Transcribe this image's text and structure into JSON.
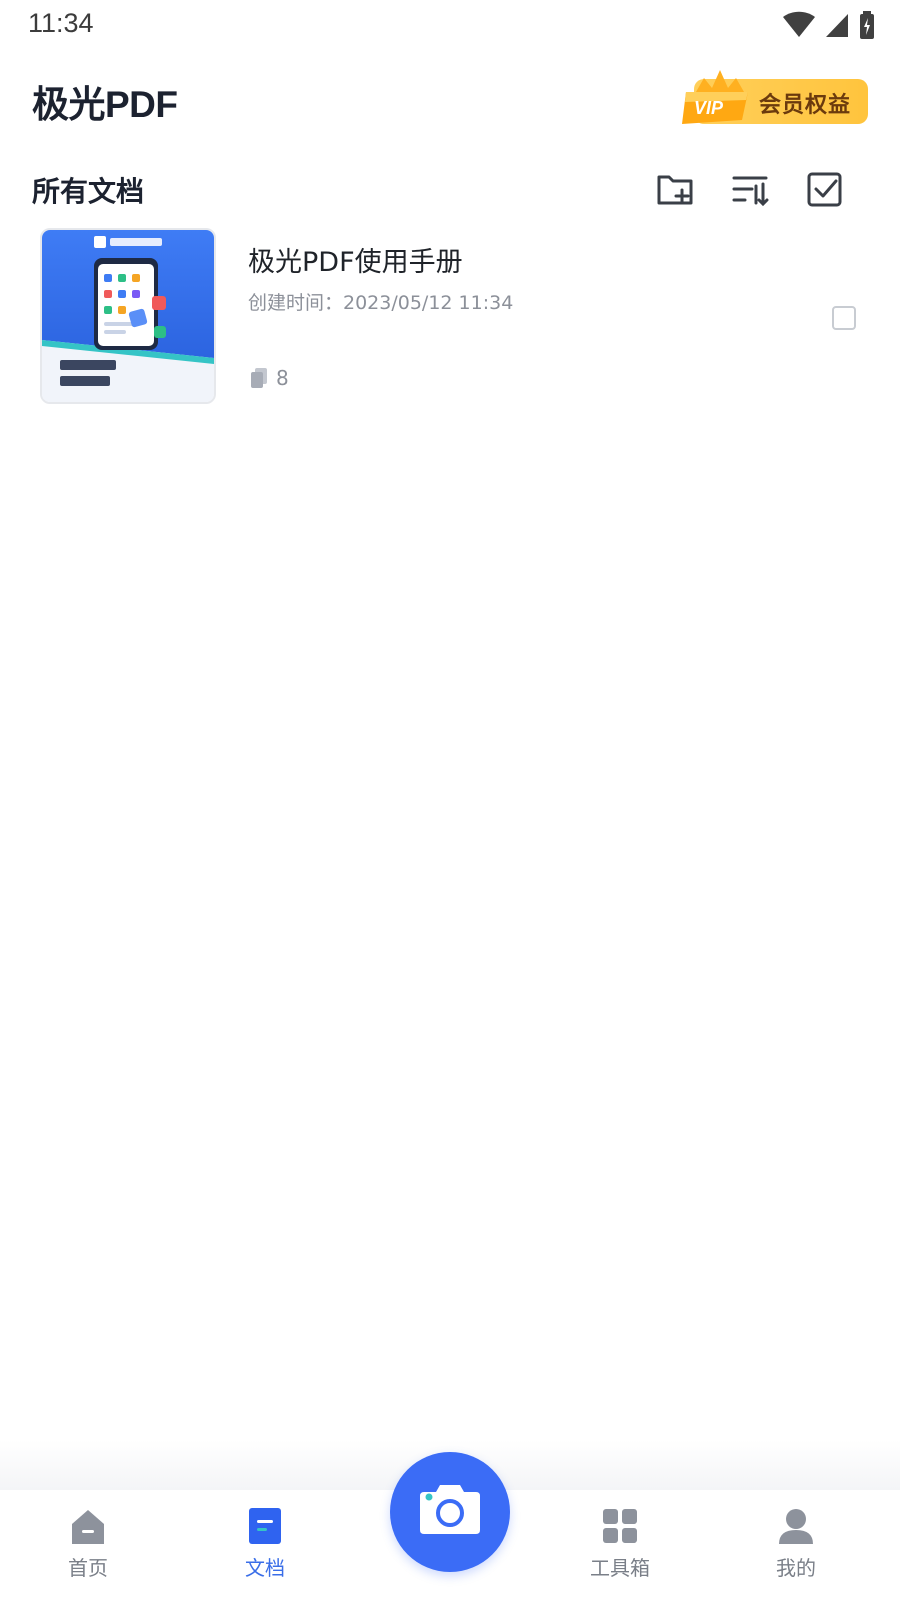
{
  "status_bar": {
    "time": "11:34"
  },
  "header": {
    "app_title": "极光PDF",
    "vip_label": "会员权益",
    "vip_badge_text": "VIP"
  },
  "section": {
    "title": "所有文档",
    "icons": [
      "new-folder-icon",
      "sort-icon",
      "multi-select-icon"
    ]
  },
  "documents": [
    {
      "title": "极光PDF使用手册",
      "created": "创建时间：2023/05/12 11:34",
      "pages": "8",
      "thumbnail_text": "极光PDF使用手册",
      "selected": false
    }
  ],
  "bottom_nav": {
    "items": [
      {
        "label": "首页",
        "icon": "home-icon",
        "active": false
      },
      {
        "label": "文档",
        "icon": "document-icon",
        "active": true
      },
      {
        "label": "工具箱",
        "icon": "toolbox-icon",
        "active": false
      },
      {
        "label": "我的",
        "icon": "profile-icon",
        "active": false
      }
    ],
    "camera_icon": "camera-icon"
  },
  "colors": {
    "accent": "#3b6cf6",
    "vip_gold": "#ffc43d",
    "text_primary": "#1f2329",
    "text_secondary": "#8c9099"
  }
}
